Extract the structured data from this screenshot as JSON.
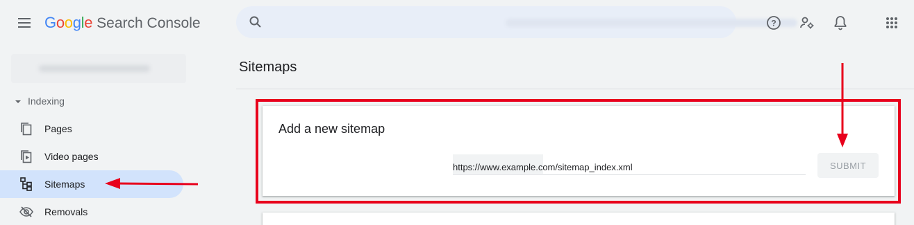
{
  "header": {
    "logo_google": "Google",
    "logo_product": "Search Console",
    "search_placeholder": "",
    "icons": [
      "menu-icon",
      "search-icon",
      "help-icon",
      "admin-settings-icon",
      "bell-icon",
      "apps-grid-icon"
    ]
  },
  "sidebar": {
    "section_label": "Indexing",
    "items": [
      {
        "label": "Pages",
        "icon": "pages-icon"
      },
      {
        "label": "Video pages",
        "icon": "video-pages-icon"
      },
      {
        "label": "Sitemaps",
        "icon": "sitemap-icon",
        "active": true
      },
      {
        "label": "Removals",
        "icon": "removals-icon"
      }
    ]
  },
  "main": {
    "title": "Sitemaps",
    "card": {
      "title": "Add a new sitemap",
      "input_value": "https://www.example.com/sitemap_index.xml",
      "submit_label": "SUBMIT"
    }
  },
  "colors": {
    "background": "#f1f3f4",
    "active_nav": "#d2e3fc",
    "annotation_red": "#e8001c",
    "search_bg": "#e8eef8"
  }
}
